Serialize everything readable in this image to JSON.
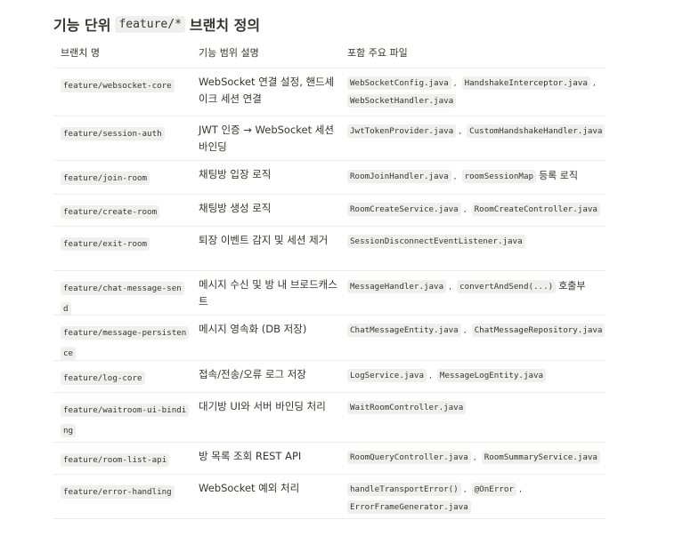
{
  "heading": {
    "prefix": "기능 단위",
    "code": "feature/*",
    "suffix": "브랜치 정의"
  },
  "table": {
    "headers": [
      "브랜치 명",
      "기능 범위 설명",
      "포함 주요 파일"
    ],
    "rows": [
      {
        "branch": "feature/websocket-core",
        "description": "WebSocket 연결 설정, 핸드셰이크 세션 연결",
        "files": [
          {
            "text": "WebSocketConfig.java",
            "code": true
          },
          {
            "text": ",",
            "code": false
          },
          {
            "text": "HandshakeInterceptor.java",
            "code": true
          },
          {
            "text": ",",
            "code": false
          },
          {
            "text": "WebSocketHandler.java",
            "code": true
          }
        ]
      },
      {
        "branch": "feature/session-auth",
        "description": "JWT 인증 → WebSocket 세션 바인딩",
        "files": [
          {
            "text": "JwtTokenProvider.java",
            "code": true
          },
          {
            "text": ",",
            "code": false
          },
          {
            "text": "CustomHandshakeHandler.java",
            "code": true
          }
        ]
      },
      {
        "branch": "feature/join-room",
        "description": "채팅방 입장 로직",
        "files": [
          {
            "text": "RoomJoinHandler.java",
            "code": true
          },
          {
            "text": ",",
            "code": false
          },
          {
            "text": "roomSessionMap",
            "code": true
          },
          {
            "text": "등록 로직",
            "code": false
          }
        ]
      },
      {
        "branch": "feature/create-room",
        "description": "채팅방 생성 로직",
        "files": [
          {
            "text": "RoomCreateService.java",
            "code": true
          },
          {
            "text": ",",
            "code": false
          },
          {
            "text": "RoomCreateController.java",
            "code": true
          }
        ]
      },
      {
        "branch": "feature/exit-room",
        "description": "퇴장 이벤트 감지 및 세션 제거",
        "files": [
          {
            "text": "SessionDisconnectEventListener.java",
            "code": true
          }
        ]
      },
      {
        "branch": "feature/chat-message-send",
        "description": "메시지 수신 및 방 내 브로드캐스트",
        "files": [
          {
            "text": "MessageHandler.java",
            "code": true
          },
          {
            "text": ",",
            "code": false
          },
          {
            "text": "convertAndSend(...)",
            "code": true
          },
          {
            "text": "호출부",
            "code": false
          }
        ]
      },
      {
        "branch": "feature/message-persistence",
        "description": "메시지 영속화 (DB 저장)",
        "files": [
          {
            "text": "ChatMessageEntity.java",
            "code": true
          },
          {
            "text": ",",
            "code": false
          },
          {
            "text": "ChatMessageRepository.java",
            "code": true
          }
        ]
      },
      {
        "branch": "feature/log-core",
        "description": "접속/전송/오류 로그 저장",
        "files": [
          {
            "text": "LogService.java",
            "code": true
          },
          {
            "text": ",",
            "code": false
          },
          {
            "text": "MessageLogEntity.java",
            "code": true
          }
        ]
      },
      {
        "branch": "feature/waitroom-ui-binding",
        "description": "대기방 UI와 서버 바인딩 처리",
        "files": [
          {
            "text": "WaitRoomController.java",
            "code": true
          }
        ]
      },
      {
        "branch": "feature/room-list-api",
        "description": "방 목록 조회 REST API",
        "files": [
          {
            "text": "RoomQueryController.java",
            "code": true
          },
          {
            "text": ",",
            "code": false
          },
          {
            "text": "RoomSummaryService.java",
            "code": true
          }
        ]
      },
      {
        "branch": "feature/error-handling",
        "description": "WebSocket 예외 처리",
        "files": [
          {
            "text": "handleTransportError()",
            "code": true
          },
          {
            "text": ",",
            "code": false
          },
          {
            "text": "@OnError",
            "code": true
          },
          {
            "text": ",",
            "code": false
          },
          {
            "text": "ErrorFrameGenerator.java",
            "code": true
          }
        ]
      }
    ]
  }
}
